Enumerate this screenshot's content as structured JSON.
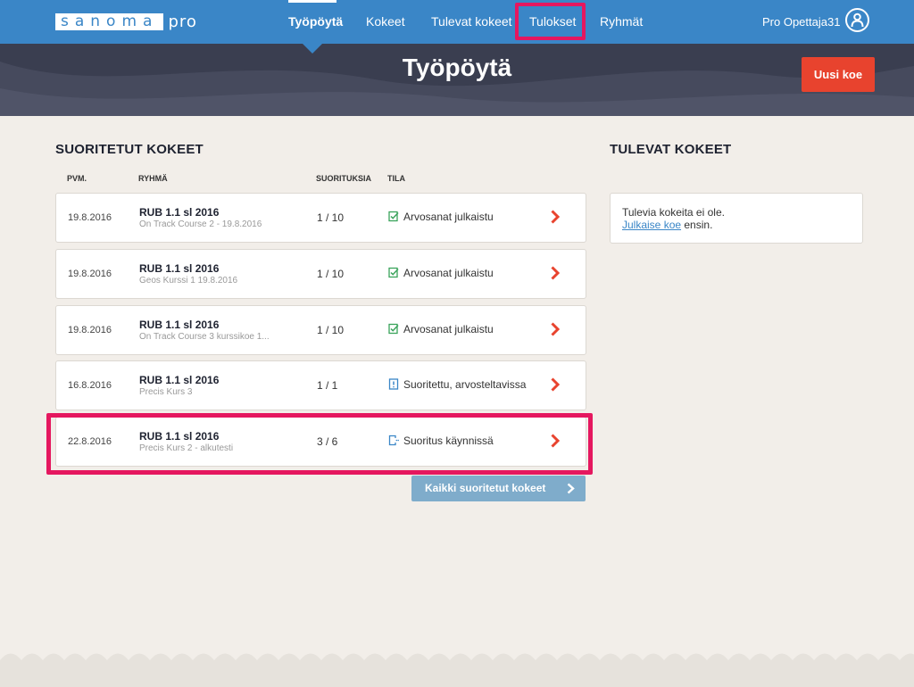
{
  "logo": {
    "brand": "sanoma",
    "suffix": "pro"
  },
  "nav": {
    "items": [
      {
        "label": "Työpöytä"
      },
      {
        "label": "Kokeet"
      },
      {
        "label": "Tulevat kokeet"
      },
      {
        "label": "Tulokset"
      },
      {
        "label": "Ryhmät"
      }
    ],
    "user_name": "Pro Opettaja31"
  },
  "hero": {
    "title": "Työpöytä",
    "new_test_label": "Uusi koe"
  },
  "completed": {
    "title": "SUORITETUT KOKEET",
    "columns": {
      "date": "PVM.",
      "group": "RYHMÄ",
      "count": "SUORITUKSIA",
      "status": "TILA"
    },
    "rows": [
      {
        "date": "19.8.2016",
        "group": "RUB 1.1 sl 2016",
        "course": "On Track Course 2 - 19.8.2016",
        "count": "1 / 10",
        "status": "Arvosanat julkaistu",
        "status_icon": "published-check-icon"
      },
      {
        "date": "19.8.2016",
        "group": "RUB 1.1 sl 2016",
        "course": "Geos Kurssi 1 19.8.2016",
        "count": "1 / 10",
        "status": "Arvosanat julkaistu",
        "status_icon": "published-check-icon"
      },
      {
        "date": "19.8.2016",
        "group": "RUB 1.1 sl 2016",
        "course": "On Track Course 3 kurssikoe 1...",
        "count": "1 / 10",
        "status": "Arvosanat julkaistu",
        "status_icon": "published-check-icon"
      },
      {
        "date": "16.8.2016",
        "group": "RUB 1.1 sl 2016",
        "course": "Precis Kurs 3",
        "count": "1 / 1",
        "status": "Suoritettu, arvosteltavissa",
        "status_icon": "gradable-exclamation-icon"
      },
      {
        "date": "22.8.2016",
        "group": "RUB 1.1 sl 2016",
        "course": "Precis Kurs 2 - alkutesti",
        "count": "3 / 6",
        "status": "Suoritus käynnissä",
        "status_icon": "in-progress-icon"
      }
    ],
    "all_button": "Kaikki suoritetut kokeet"
  },
  "upcoming": {
    "title": "TULEVAT KOKEET",
    "empty_text": "Tulevia kokeita ei ole.",
    "link_text": "Julkaise koe",
    "after_link": " ensin."
  },
  "colors": {
    "nav_blue": "#3a86c7",
    "accent_red": "#e8432e",
    "highlight_pink": "#e5175f",
    "status_green": "#3aa35b",
    "status_blue": "#3a86c7"
  }
}
